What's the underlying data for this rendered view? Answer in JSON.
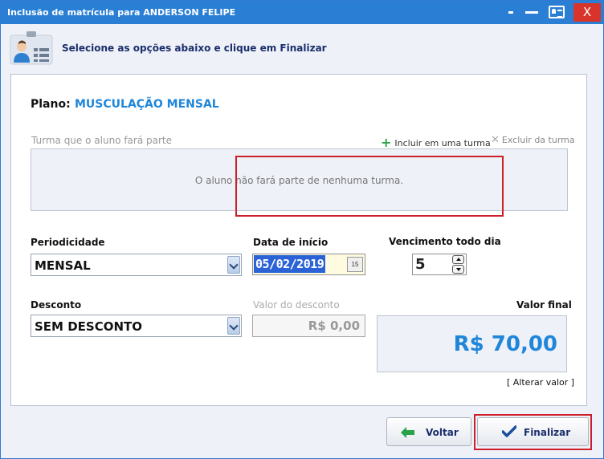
{
  "window": {
    "title": "Inclusão de matrícula para ANDERSON FELIPE",
    "close_label": "X"
  },
  "header": {
    "instruction": "Selecione as opções abaixo e clique em Finalizar"
  },
  "plano": {
    "label": "Plano:",
    "value": "MUSCULAÇÃO MENSAL"
  },
  "turma": {
    "label": "Turma que o aluno fará parte",
    "add_label": "Incluir em uma turma",
    "remove_label": "Excluir da turma",
    "empty_text": "O aluno não fará parte de nenhuma turma."
  },
  "periodicidade": {
    "label": "Periodicidade",
    "value": "MENSAL"
  },
  "data_inicio": {
    "label": "Data de início",
    "value": "05/02/2019",
    "calendar_glyph": "15"
  },
  "vencimento": {
    "label": "Vencimento todo dia",
    "value": "5"
  },
  "desconto": {
    "label": "Desconto",
    "value": "SEM DESCONTO"
  },
  "valor_desconto": {
    "label": "Valor do desconto",
    "value": "R$ 0,00"
  },
  "valor_final": {
    "label": "Valor final",
    "value": "R$ 70,00",
    "alter_label": "[ Alterar valor ]"
  },
  "buttons": {
    "voltar": "Voltar",
    "finalizar": "Finalizar"
  },
  "colors": {
    "titlebar": "#2a7fd4",
    "accent_blue": "#1f86d9",
    "highlight_red": "#cc1f2a",
    "add_green": "#2aa24a"
  }
}
